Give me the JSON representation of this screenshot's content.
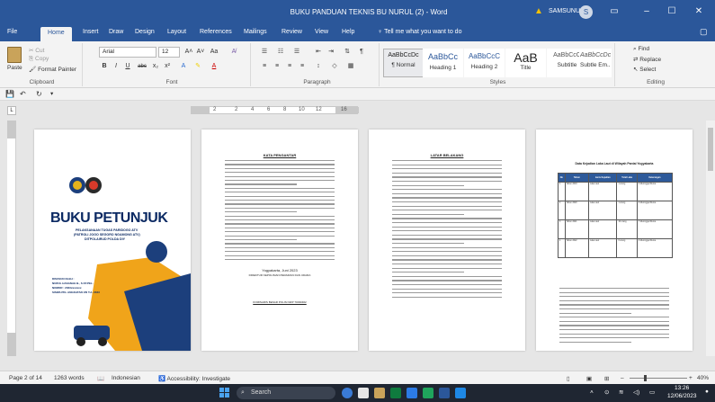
{
  "window": {
    "title": "BUKU PANDUAN TEKNIS BU NURUL (2) - Word",
    "user": "SAMSUNU",
    "avatar_initial": "S",
    "warn_icon": "warning-icon"
  },
  "tabs": [
    "File",
    "Home",
    "Insert",
    "Draw",
    "Design",
    "Layout",
    "References",
    "Mailings",
    "Review",
    "View",
    "Help"
  ],
  "tell_me": "Tell me what you want to do",
  "clipboard": {
    "paste": "Paste",
    "cut": "Cut",
    "copy": "Copy",
    "format_painter": "Format Painter",
    "label": "Clipboard"
  },
  "font": {
    "name": "Arial",
    "size": "12",
    "label": "Font",
    "bold": "B",
    "italic": "I",
    "underline": "U",
    "strike": "abc",
    "sub": "x₂",
    "sup": "x²"
  },
  "paragraph": {
    "label": "Paragraph"
  },
  "styles": {
    "label": "Styles",
    "items": [
      {
        "sample": "AaBbCcDc",
        "name": "¶ Normal"
      },
      {
        "sample": "AaBbCc",
        "name": "Heading 1"
      },
      {
        "sample": "AaBbCcC",
        "name": "Heading 2"
      },
      {
        "sample": "AaB",
        "name": "Title"
      },
      {
        "sample": "AaBbCcC",
        "name": "Subtitle"
      },
      {
        "sample": "AaBbCcDc",
        "name": "Subtle Em..."
      }
    ]
  },
  "editing": {
    "find": "Find",
    "replace": "Replace",
    "select": "Select",
    "label": "Editing"
  },
  "ruler": {
    "numbers": [
      "2",
      "2",
      "4",
      "6",
      "8",
      "10",
      "12",
      "16"
    ]
  },
  "pages": {
    "cover": {
      "title": "BUKU PETUNJUK",
      "sub1": "PELAKSANAAN TUGAS PARIDOGO ATV",
      "sub2": "(PATROLI JOGO SEGORO NGAMONG ATV)",
      "sub3": "DITPOLAIRUD POLDA DIY",
      "author1": "DISUSUN OLEH :",
      "author2": "NURUL HASANAH B., S.ST.PEL.",
      "author3": "NOMOR : 2023xxxxxxx",
      "author4": "SISWA PKL ANGKATAN VIII T.A. 2023"
    },
    "p2": {
      "heading": "KATA PENGANTAR",
      "sign": "Yogyakarta,        Juni 2023",
      "sign2": "DIREKTUR KEPOLISIAN PERAIRAN DAN UDARA",
      "sign3": "KOMISARIS BESAR POLISI NRP 70030462"
    },
    "p3": {
      "heading": "LATAR BELAKANG"
    },
    "p4": {
      "heading": "Data Kejadian Laka Laut di Wilayah Pantai Yogyakarta",
      "cols": [
        "No",
        "Tahun",
        "Jenis Kejadian",
        "Total Laka",
        "Keterangan"
      ],
      "rows": [
        [
          "1",
          "Tahun 2019",
          "Laka Laut",
          "1 orang",
          "4 Meninggal Dunia"
        ],
        [
          "2",
          "Tahun 2020",
          "Laka Laut",
          "1 orang",
          "3 Meninggal Dunia"
        ],
        [
          "3",
          "Tahun 2021",
          "Laka Laut",
          "10 orang",
          "7 Meninggal Dunia"
        ],
        [
          "4",
          "Tahun 2022",
          "Laka Laut",
          "6 orang",
          "3 Meninggal Dunia"
        ]
      ]
    }
  },
  "status": {
    "page": "Page 2 of 14",
    "words": "1263 words",
    "language": "Indonesian",
    "accessibility": "Accessibility: Investigate",
    "zoom": "40%"
  },
  "taskbar": {
    "search": "Search",
    "time": "13:26",
    "date": "12/06/2023"
  }
}
